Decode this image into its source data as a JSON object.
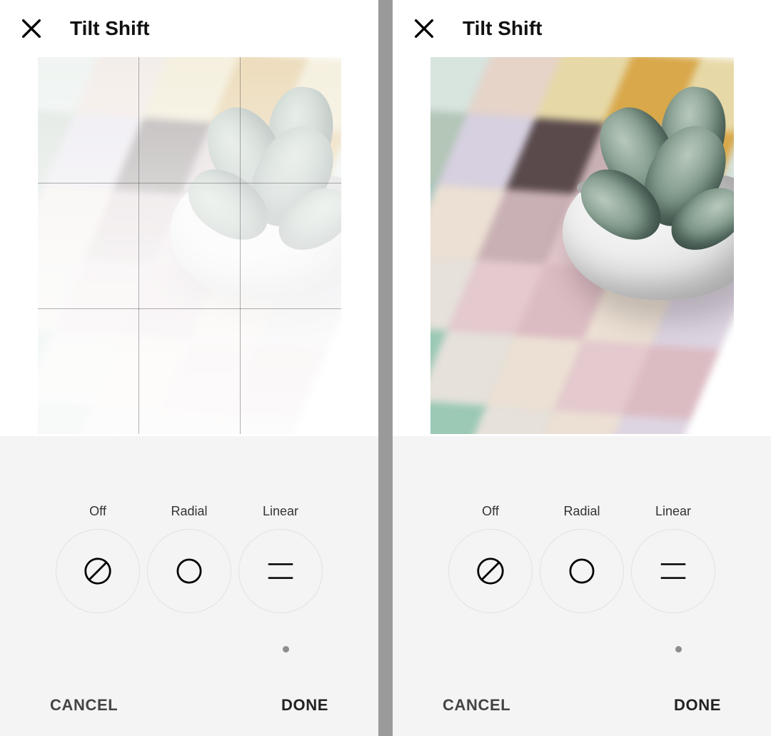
{
  "panes": {
    "left": {
      "title": "Tilt Shift",
      "show_grid": true,
      "whiten": true,
      "options": {
        "off": "Off",
        "radial": "Radial",
        "linear": "Linear"
      },
      "footer": {
        "cancel": "CANCEL",
        "done": "DONE"
      }
    },
    "right": {
      "title": "Tilt Shift",
      "show_grid": false,
      "whiten": false,
      "options": {
        "off": "Off",
        "radial": "Radial",
        "linear": "Linear"
      },
      "footer": {
        "cancel": "CANCEL",
        "done": "DONE"
      }
    }
  },
  "icons": {
    "close": "close-icon",
    "off": "slash-circle-icon",
    "radial": "circle-icon",
    "linear": "linear-icon"
  }
}
